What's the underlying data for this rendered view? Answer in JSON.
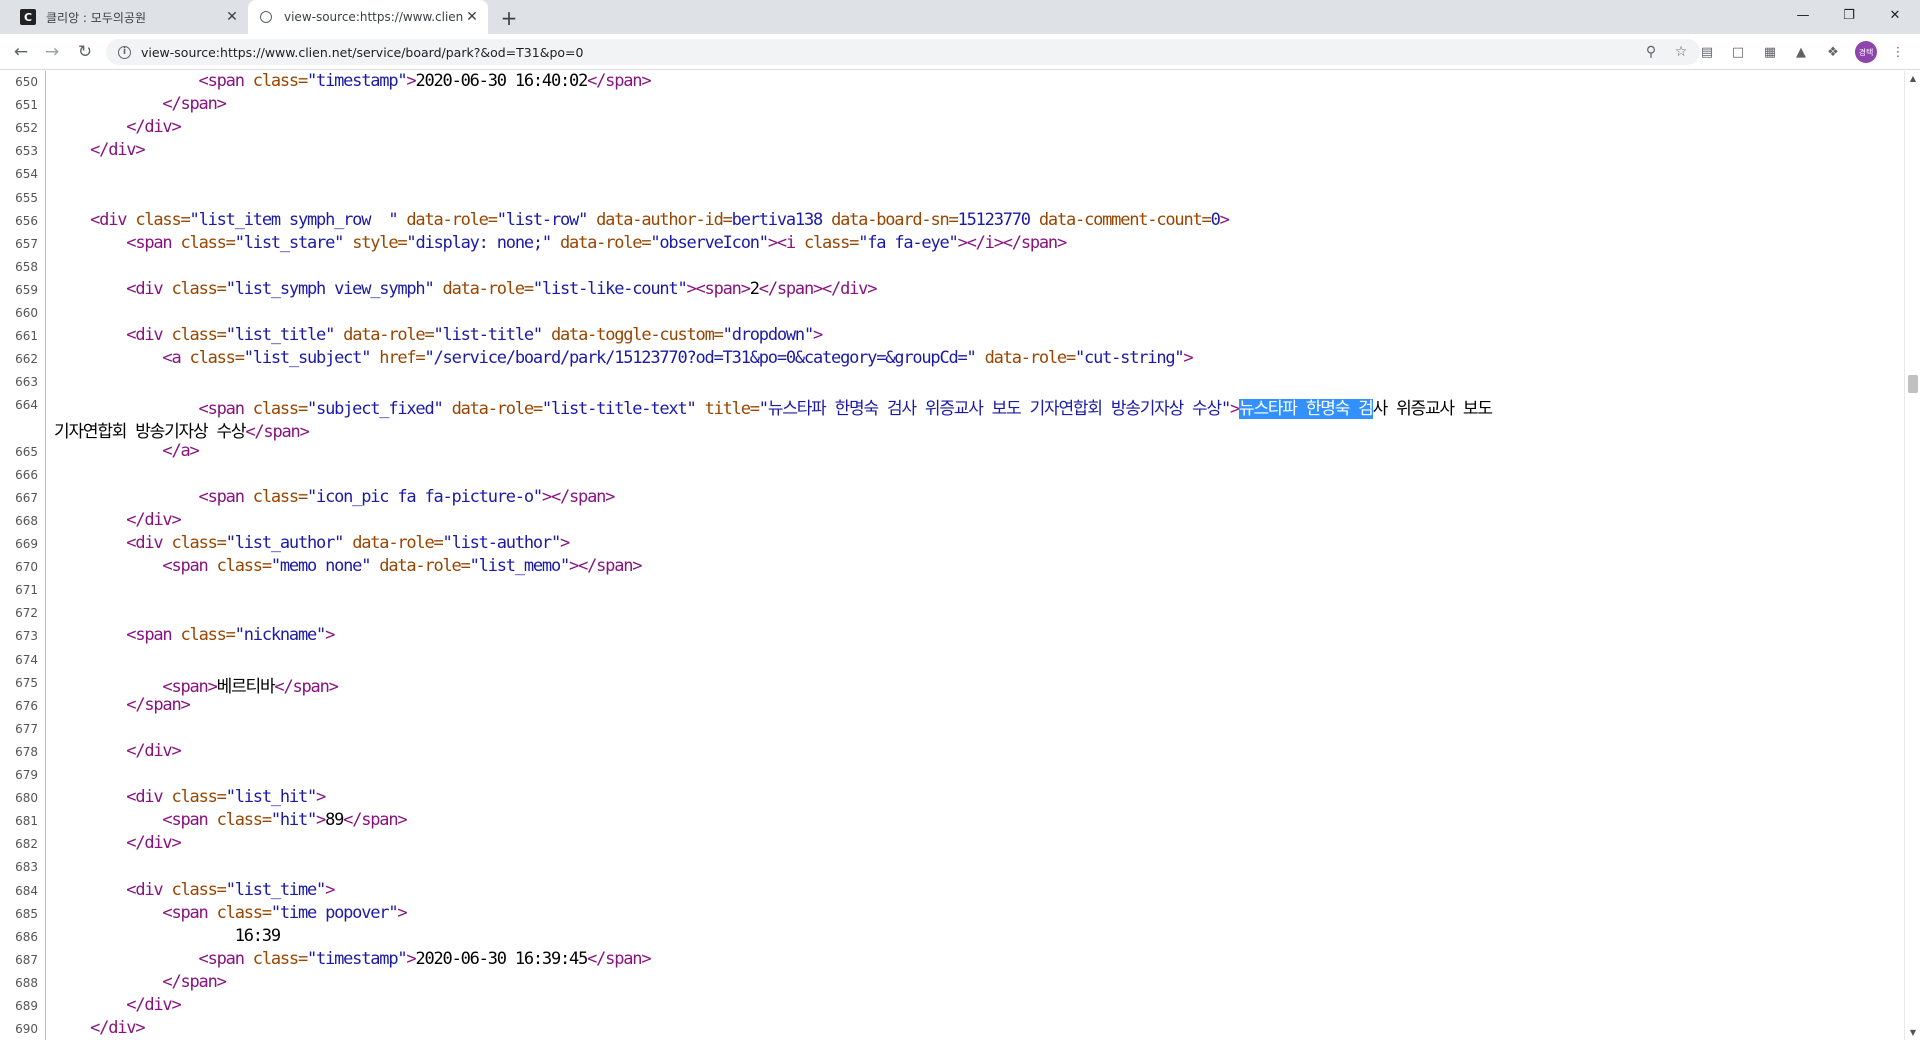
{
  "tabs": [
    {
      "title": "클리앙 : 모두의공원",
      "favicon": "clien-c-icon"
    },
    {
      "title": "view-source:https://www.clien.ne",
      "favicon": "globe-icon"
    }
  ],
  "toolbar": {
    "url": "view-source:https://www.clien.net/service/board/park?&od=T31&po=0",
    "avatar_text": "경택"
  },
  "colors": {
    "tag": "#881280",
    "attr": "#994500",
    "value": "#1a1aa6",
    "selection": "#3390ff"
  },
  "source": {
    "lines": [
      {
        "n": "650",
        "segments": [
          [
            "t",
            "                <span "
          ],
          [
            "a",
            "class="
          ],
          [
            "v",
            "\"timestamp\""
          ],
          [
            "t",
            ">"
          ],
          [
            "x",
            "2020-06-30 16:40:02"
          ],
          [
            "t",
            "</span>"
          ]
        ]
      },
      {
        "n": "651",
        "segments": [
          [
            "t",
            "            </span>"
          ]
        ]
      },
      {
        "n": "652",
        "segments": [
          [
            "t",
            "        </div>"
          ]
        ]
      },
      {
        "n": "653",
        "segments": [
          [
            "t",
            "    </div>"
          ]
        ]
      },
      {
        "n": "654",
        "segments": []
      },
      {
        "n": "655",
        "segments": []
      },
      {
        "n": "656",
        "segments": [
          [
            "t",
            "    <div "
          ],
          [
            "a",
            "class="
          ],
          [
            "v",
            "\"list_item symph_row  \" "
          ],
          [
            "a",
            "data-role="
          ],
          [
            "v",
            "\"list-row\" "
          ],
          [
            "a",
            "data-author-id="
          ],
          [
            "v",
            "bertiva138 "
          ],
          [
            "a",
            "data-board-sn="
          ],
          [
            "v",
            "15123770 "
          ],
          [
            "a",
            "data-comment-count="
          ],
          [
            "v",
            "0"
          ],
          [
            "t",
            ">"
          ]
        ]
      },
      {
        "n": "657",
        "segments": [
          [
            "t",
            "        <span "
          ],
          [
            "a",
            "class="
          ],
          [
            "v",
            "\"list_stare\" "
          ],
          [
            "a",
            "style="
          ],
          [
            "v",
            "\"display: none;\" "
          ],
          [
            "a",
            "data-role="
          ],
          [
            "v",
            "\"observeIcon\""
          ],
          [
            "t",
            "><i "
          ],
          [
            "a",
            "class="
          ],
          [
            "v",
            "\"fa fa-eye\""
          ],
          [
            "t",
            "></i></span>"
          ]
        ]
      },
      {
        "n": "658",
        "segments": []
      },
      {
        "n": "659",
        "segments": [
          [
            "t",
            "        <div "
          ],
          [
            "a",
            "class="
          ],
          [
            "v",
            "\"list_symph view_symph\" "
          ],
          [
            "a",
            "data-role="
          ],
          [
            "v",
            "\"list-like-count\""
          ],
          [
            "t",
            "><span>"
          ],
          [
            "x",
            "2"
          ],
          [
            "t",
            "</span></div>"
          ]
        ]
      },
      {
        "n": "660",
        "segments": []
      },
      {
        "n": "661",
        "segments": [
          [
            "t",
            "        <div "
          ],
          [
            "a",
            "class="
          ],
          [
            "v",
            "\"list_title\" "
          ],
          [
            "a",
            "data-role="
          ],
          [
            "v",
            "\"list-title\" "
          ],
          [
            "a",
            "data-toggle-custom="
          ],
          [
            "v",
            "\"dropdown\""
          ],
          [
            "t",
            ">"
          ]
        ]
      },
      {
        "n": "662",
        "segments": [
          [
            "t",
            "            <a "
          ],
          [
            "a",
            "class="
          ],
          [
            "v",
            "\"list_subject\" "
          ],
          [
            "a",
            "href="
          ],
          [
            "v",
            "\"/service/board/park/15123770?od=T31&po=0&category=&groupCd=\" "
          ],
          [
            "a",
            "data-role="
          ],
          [
            "v",
            "\"cut-string\""
          ],
          [
            "t",
            ">"
          ]
        ]
      },
      {
        "n": "663",
        "segments": []
      },
      {
        "n": "664",
        "segments": [
          [
            "t",
            "                <span "
          ],
          [
            "a",
            "class="
          ],
          [
            "v",
            "\"subject_fixed\" "
          ],
          [
            "a",
            "data-role="
          ],
          [
            "v",
            "\"list-title-text\" "
          ],
          [
            "a",
            "title="
          ],
          [
            "v",
            "\"뉴스타파 한명숙 검사 위증교사 보도 기자연합회 방송기자상 수상\""
          ],
          [
            "t",
            ">"
          ],
          [
            "s",
            "뉴스타파 한명숙 검"
          ],
          [
            "x",
            "사 위증교사 보도"
          ]
        ],
        "wrap": [
          [
            "x",
            "기자연합회 방송기자상 수상"
          ],
          [
            "t",
            "</span>"
          ]
        ]
      },
      {
        "n": "665",
        "segments": [
          [
            "t",
            "            </a>"
          ]
        ]
      },
      {
        "n": "666",
        "segments": []
      },
      {
        "n": "667",
        "segments": [
          [
            "t",
            "                <span "
          ],
          [
            "a",
            "class="
          ],
          [
            "v",
            "\"icon_pic fa fa-picture-o\""
          ],
          [
            "t",
            "></span>"
          ]
        ]
      },
      {
        "n": "668",
        "segments": [
          [
            "t",
            "        </div>"
          ]
        ]
      },
      {
        "n": "669",
        "segments": [
          [
            "t",
            "        <div "
          ],
          [
            "a",
            "class="
          ],
          [
            "v",
            "\"list_author\" "
          ],
          [
            "a",
            "data-role="
          ],
          [
            "v",
            "\"list-author\""
          ],
          [
            "t",
            ">"
          ]
        ]
      },
      {
        "n": "670",
        "segments": [
          [
            "t",
            "            <span "
          ],
          [
            "a",
            "class="
          ],
          [
            "v",
            "\"memo none\" "
          ],
          [
            "a",
            "data-role="
          ],
          [
            "v",
            "\"list_memo\""
          ],
          [
            "t",
            "></span>"
          ]
        ]
      },
      {
        "n": "671",
        "segments": []
      },
      {
        "n": "672",
        "segments": []
      },
      {
        "n": "673",
        "segments": [
          [
            "t",
            "<span "
          ],
          [
            "a",
            "class="
          ],
          [
            "v",
            "\"nickname\""
          ],
          [
            "t",
            ">"
          ]
        ],
        "indent": "        "
      },
      {
        "n": "674",
        "segments": []
      },
      {
        "n": "675",
        "segments": [
          [
            "t",
            "            <span>"
          ],
          [
            "x",
            "베르티바"
          ],
          [
            "t",
            "</span>"
          ]
        ]
      },
      {
        "n": "676",
        "segments": [
          [
            "t",
            "        </span>"
          ]
        ]
      },
      {
        "n": "677",
        "segments": []
      },
      {
        "n": "678",
        "segments": [
          [
            "t",
            "        </div>"
          ]
        ]
      },
      {
        "n": "679",
        "segments": []
      },
      {
        "n": "680",
        "segments": [
          [
            "t",
            "        <div "
          ],
          [
            "a",
            "class="
          ],
          [
            "v",
            "\"list_hit\""
          ],
          [
            "t",
            ">"
          ]
        ]
      },
      {
        "n": "681",
        "segments": [
          [
            "t",
            "            <span "
          ],
          [
            "a",
            "class="
          ],
          [
            "v",
            "\"hit\""
          ],
          [
            "t",
            ">"
          ],
          [
            "x",
            "89"
          ],
          [
            "t",
            "</span>"
          ]
        ]
      },
      {
        "n": "682",
        "segments": [
          [
            "t",
            "        </div>"
          ]
        ]
      },
      {
        "n": "683",
        "segments": []
      },
      {
        "n": "684",
        "segments": [
          [
            "t",
            "        <div "
          ],
          [
            "a",
            "class="
          ],
          [
            "v",
            "\"list_time\""
          ],
          [
            "t",
            ">"
          ]
        ]
      },
      {
        "n": "685",
        "segments": [
          [
            "t",
            "            <span "
          ],
          [
            "a",
            "class="
          ],
          [
            "v",
            "\"time popover\""
          ],
          [
            "t",
            ">"
          ]
        ]
      },
      {
        "n": "686",
        "segments": [
          [
            "x",
            "                    16:39"
          ]
        ]
      },
      {
        "n": "687",
        "segments": [
          [
            "t",
            "                <span "
          ],
          [
            "a",
            "class="
          ],
          [
            "v",
            "\"timestamp\""
          ],
          [
            "t",
            ">"
          ],
          [
            "x",
            "2020-06-30 16:39:45"
          ],
          [
            "t",
            "</span>"
          ]
        ]
      },
      {
        "n": "688",
        "segments": [
          [
            "t",
            "            </span>"
          ]
        ]
      },
      {
        "n": "689",
        "segments": [
          [
            "t",
            "        </div>"
          ]
        ]
      },
      {
        "n": "690",
        "segments": [
          [
            "t",
            "    </div>"
          ]
        ]
      }
    ]
  }
}
